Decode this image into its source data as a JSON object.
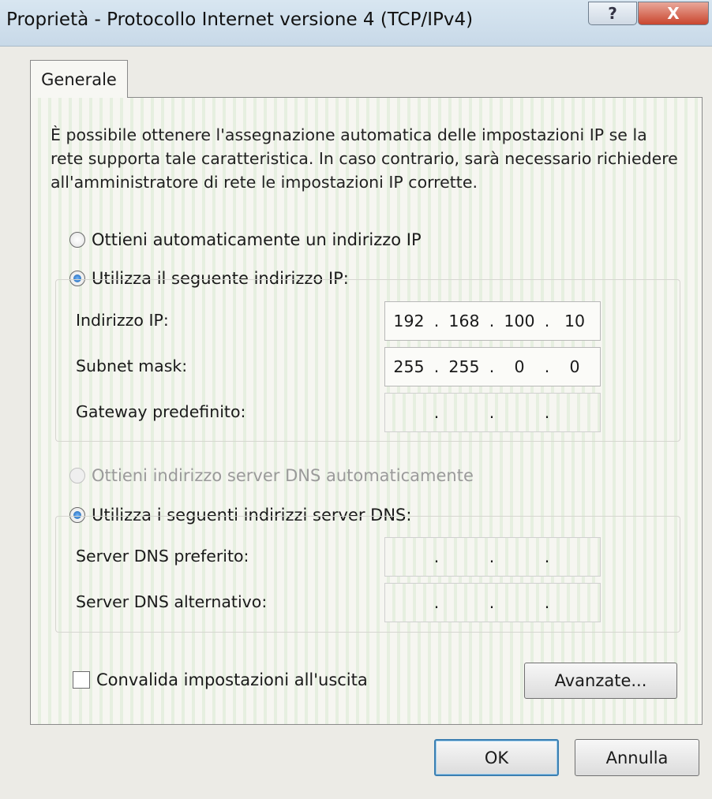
{
  "window": {
    "title": "Proprietà - Protocollo Internet versione 4 (TCP/IPv4)",
    "help_glyph": "?",
    "close_glyph": "X"
  },
  "tabs": [
    {
      "label": "Generale"
    }
  ],
  "intro_text": "È possibile ottenere l'assegnazione automatica delle impostazioni IP se la rete supporta tale caratteristica. In caso contrario, sarà necessario richiedere all'amministratore di rete le impostazioni IP corrette.",
  "ip_mode": {
    "auto_label": "Ottieni automaticamente un indirizzo IP",
    "manual_label": "Utilizza il seguente indirizzo IP:",
    "selected": "manual"
  },
  "ip_fields": {
    "ip_address": {
      "label": "Indirizzo IP:",
      "octets": [
        "192",
        "168",
        "100",
        "10"
      ]
    },
    "subnet_mask": {
      "label": "Subnet mask:",
      "octets": [
        "255",
        "255",
        "0",
        "0"
      ]
    },
    "gateway": {
      "label": "Gateway predefinito:",
      "octets": [
        "",
        "",
        "",
        ""
      ]
    }
  },
  "dns_mode": {
    "auto_label": "Ottieni indirizzo server DNS automaticamente",
    "manual_label": "Utilizza i seguenti indirizzi server DNS:",
    "selected": "manual",
    "auto_disabled": true
  },
  "dns_fields": {
    "preferred": {
      "label": "Server DNS preferito:",
      "octets": [
        "",
        "",
        "",
        ""
      ]
    },
    "alternate": {
      "label": "Server DNS alternativo:",
      "octets": [
        "",
        "",
        "",
        ""
      ]
    }
  },
  "validate": {
    "label": "Convalida impostazioni all'uscita",
    "checked": false
  },
  "buttons": {
    "advanced": "Avanzate...",
    "ok": "OK",
    "cancel": "Annulla"
  }
}
